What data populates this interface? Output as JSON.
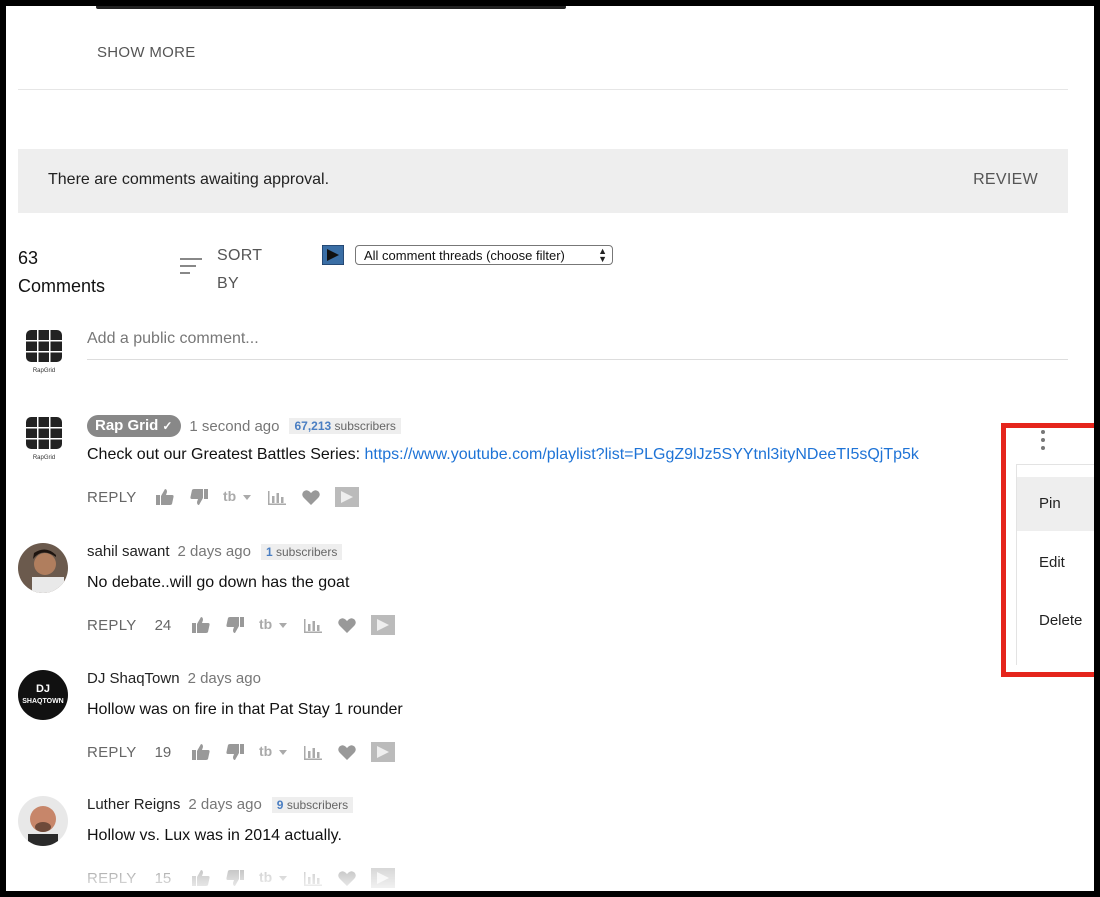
{
  "header": {
    "show_more_label": "SHOW MORE"
  },
  "banner": {
    "text": "There are comments awaiting approval.",
    "review_label": "REVIEW"
  },
  "comments_header": {
    "count": "63",
    "count_label": "Comments",
    "sort_label_line1": "SORT",
    "sort_label_line2": "BY",
    "filter_selected": "All comment threads (choose filter)"
  },
  "composer": {
    "placeholder": "Add a public comment..."
  },
  "comments": [
    {
      "author": "Rap Grid",
      "time": "1 second ago",
      "subscribers_count": "67,213",
      "subscribers_word": "subscribers",
      "text": "Check out our Greatest Battles Series: ",
      "link": "https://www.youtube.com/playlist?list=PLGgZ9lJz5SYYtnl3ityNDeeTI5sQjTp5k",
      "reply_label": "REPLY",
      "likes": ""
    },
    {
      "author": "sahil sawant",
      "time": "2 days ago",
      "subscribers_count": "1",
      "subscribers_word": "subscribers",
      "text": "No debate..will go down has the goat",
      "reply_label": "REPLY",
      "likes": "24"
    },
    {
      "author": "DJ ShaqTown",
      "time": "2 days ago",
      "text": "Hollow was on fire in that Pat Stay 1 rounder",
      "reply_label": "REPLY",
      "likes": "19"
    },
    {
      "author": "Luther Reigns",
      "time": "2 days ago",
      "subscribers_count": "9",
      "subscribers_word": "subscribers",
      "text": "Hollow vs. Lux was in 2014 actually.",
      "reply_label": "REPLY",
      "likes": "15"
    }
  ],
  "context_menu": {
    "items": [
      "Pin",
      "Edit",
      "Delete"
    ]
  },
  "avatars": {
    "dj_avatar_text_1": "DJ",
    "dj_avatar_text_2": "SHAQTOWN",
    "brand_caption": "RapGrid"
  },
  "colors": {
    "highlight_box": "#e5251c",
    "link": "#1e73d6",
    "banner_bg": "#eeeeee"
  }
}
